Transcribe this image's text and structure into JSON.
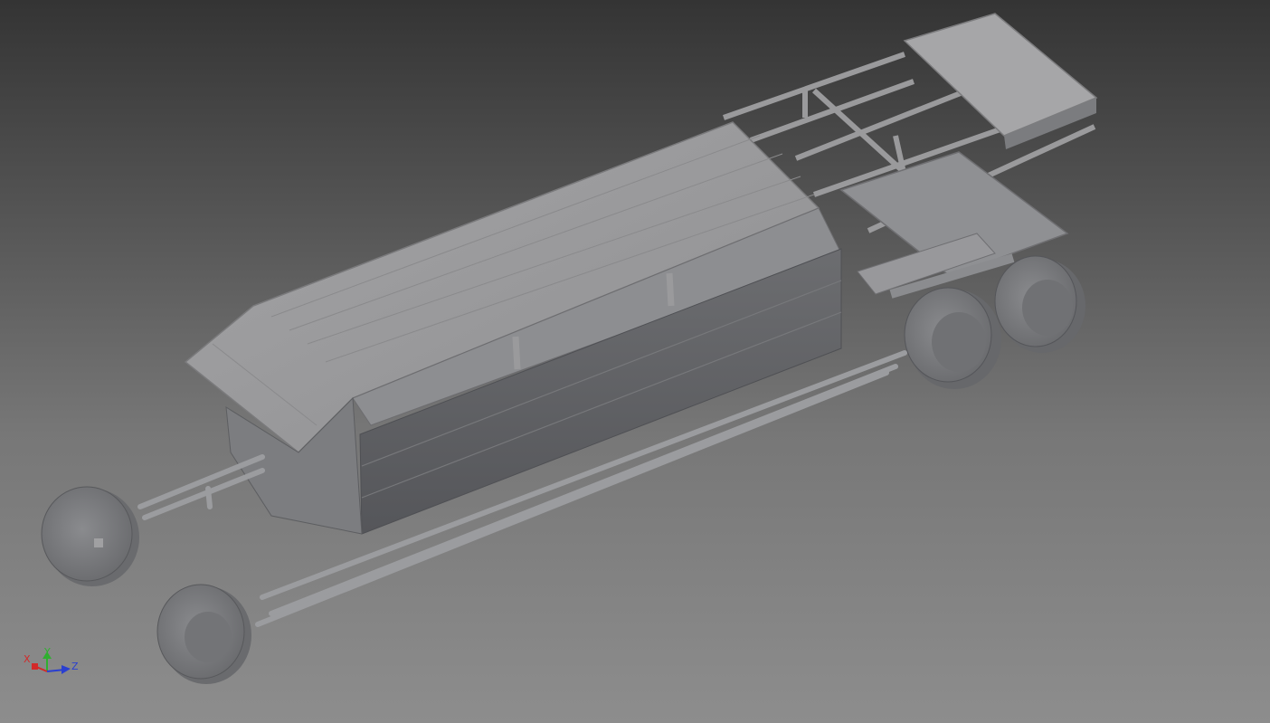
{
  "viewport": {
    "background_top": "#343434",
    "background_bottom": "#8d8d8d",
    "model_color": "#9a9a9c",
    "model_shadow": "#5c5d60"
  },
  "triad": {
    "x_label": "X",
    "y_label": "Y",
    "z_label": "Z",
    "x_color": "#d22a2a",
    "y_color": "#2fb02f",
    "z_color": "#2a3fd0"
  }
}
